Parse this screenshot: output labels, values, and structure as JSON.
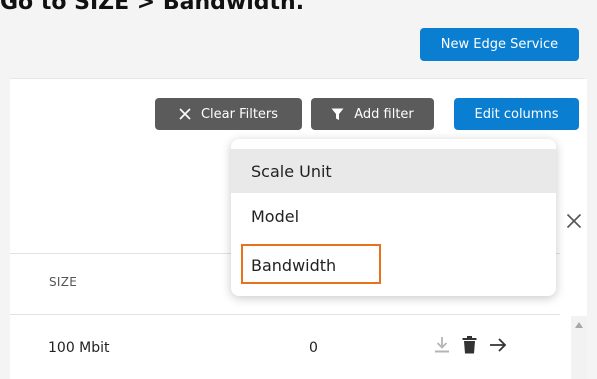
{
  "instruction": "Go to SIZE > Bandwidth.",
  "toolbar": {
    "new_edge_service": "New Edge Service",
    "clear_filters": "Clear Filters",
    "add_filter": "Add filter",
    "edit_columns": "Edit columns"
  },
  "filter_dropdown": {
    "items": [
      {
        "label": "Scale Unit",
        "highlighted": true
      },
      {
        "label": "Model",
        "highlighted": false
      },
      {
        "label": "Bandwidth",
        "highlighted": false,
        "callout": true
      }
    ]
  },
  "table": {
    "columns": [
      "SIZE"
    ],
    "rows": [
      {
        "size": "100 Mbit",
        "count": "0"
      }
    ]
  },
  "icons": {
    "clear": "close-icon",
    "filter": "funnel-icon",
    "dismiss": "close-icon",
    "download": "download-icon",
    "delete": "trash-icon",
    "open": "arrow-right-icon"
  },
  "colors": {
    "primary_button": "#0a7fd1",
    "secondary_button": "#5b5b5b",
    "callout_border": "#e8731c"
  }
}
